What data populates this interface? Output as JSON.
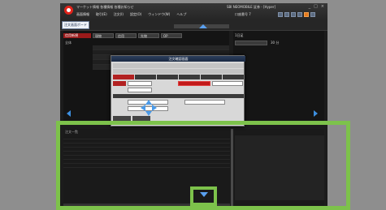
{
  "window": {
    "title": "マーケット情報 各種情報 各種お知らせ",
    "right_title": "SBI NEOMOBILE 証券 - [Hyper]",
    "menu": [
      "画面情報",
      "取引(E)",
      "注文(I)",
      "設定(O)",
      "ウィンドウ(W)",
      "ヘルプ"
    ],
    "account_label": "口座番号 7",
    "controls": [
      "_",
      "□",
      "×"
    ]
  },
  "toolbar": {
    "tab_label": "注文画面ボード",
    "search_placeholder": ""
  },
  "left_panel": {
    "header_label": "信用新規",
    "tabs": [
      "現物",
      "信用",
      "先物",
      "OP"
    ],
    "info_label": "全体"
  },
  "right_panel": {
    "label": "1日足",
    "sub_label": "30 分"
  },
  "dialog": {
    "title": "注文確認画面"
  },
  "bottom": {
    "status": "注文一覧"
  },
  "colors": {
    "highlight": "#7dc24b",
    "nav_arrow": "#3d8fe0",
    "accent_red": "#b22222"
  },
  "icons": [
    "app-logo-icon",
    "chevron-up-icon",
    "chevron-down-icon",
    "arrow-left-icon",
    "arrow-right-icon",
    "move-cross-icon"
  ]
}
